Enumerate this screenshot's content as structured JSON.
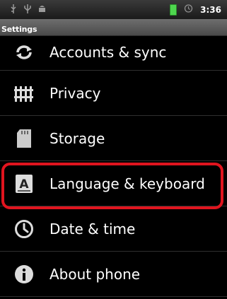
{
  "status_bar": {
    "left_icons": [
      "usb-icon",
      "usb-debug-icon",
      "android-icon"
    ],
    "clock": "3:36",
    "battery_color": "#4ed64e"
  },
  "title": "Settings",
  "items": [
    {
      "label": "Accounts & sync",
      "icon": "sync-icon"
    },
    {
      "label": "Privacy",
      "icon": "privacy-icon"
    },
    {
      "label": "Storage",
      "icon": "sd-card-icon"
    },
    {
      "label": "Language & keyboard",
      "icon": "language-icon"
    },
    {
      "label": "Date & time",
      "icon": "clock-icon"
    },
    {
      "label": "About phone",
      "icon": "info-icon"
    }
  ],
  "highlight_color": "#e0141e"
}
